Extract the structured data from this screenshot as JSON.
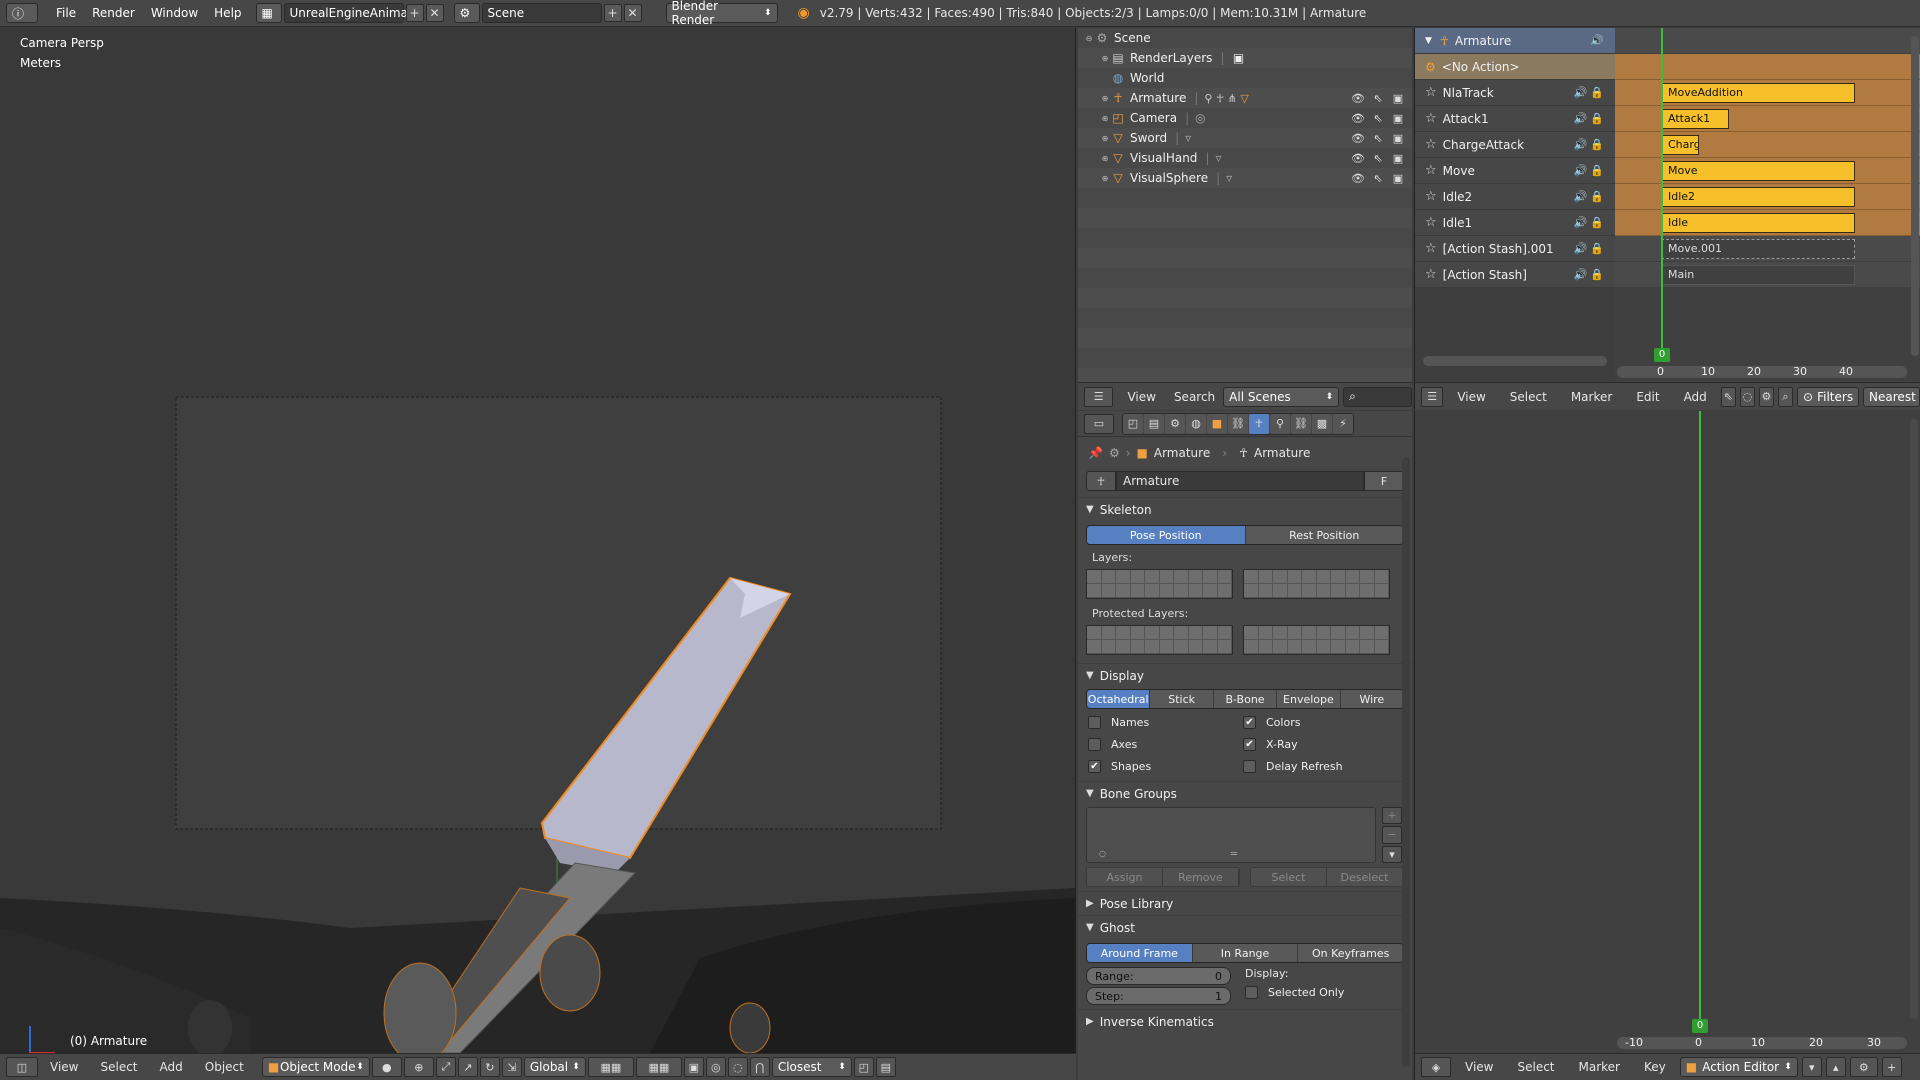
{
  "topbar": {
    "menus": [
      "File",
      "Render",
      "Window",
      "Help"
    ],
    "screen_layout": "UnrealEngineAnima...",
    "scene": "Scene",
    "engine": "Blender Render",
    "stats": "v2.79 | Verts:432 | Faces:490 | Tris:840 | Objects:2/3 | Lamps:0/0 | Mem:10.31M | Armature"
  },
  "viewport": {
    "view_name": "Camera Persp",
    "units": "Meters",
    "active_object": "(0) Armature",
    "footer": {
      "menus": [
        "View",
        "Select",
        "Add",
        "Object"
      ],
      "mode": "Object Mode",
      "orientation": "Global",
      "snap": "Closest"
    }
  },
  "outliner": {
    "rows": [
      {
        "label": "Scene",
        "icon": "scene-icon"
      },
      {
        "label": "RenderLayers",
        "icon": "render-layers-icon"
      },
      {
        "label": "World",
        "icon": "world-icon"
      },
      {
        "label": "Armature",
        "icon": "armature-icon"
      },
      {
        "label": "Camera",
        "icon": "camera-icon"
      },
      {
        "label": "Sword",
        "icon": "mesh-icon"
      },
      {
        "label": "VisualHand",
        "icon": "mesh-icon"
      },
      {
        "label": "VisualSphere",
        "icon": "mesh-icon"
      }
    ],
    "footer": {
      "menus": [
        "View",
        "Search"
      ],
      "filter": "All Scenes"
    }
  },
  "properties": {
    "breadcrumb": [
      "Armature",
      "Armature"
    ],
    "datablock": "Armature",
    "fake_user": "F",
    "skeleton": {
      "title": "Skeleton",
      "position_buttons": [
        "Pose Position",
        "Rest Position"
      ],
      "layers_label": "Layers:",
      "protected_label": "Protected Layers:"
    },
    "display": {
      "title": "Display",
      "types": [
        "Octahedral",
        "Stick",
        "B-Bone",
        "Envelope",
        "Wire"
      ],
      "options_left": [
        {
          "label": "Names",
          "checked": false
        },
        {
          "label": "Axes",
          "checked": false
        },
        {
          "label": "Shapes",
          "checked": true
        }
      ],
      "options_right": [
        {
          "label": "Colors",
          "checked": true
        },
        {
          "label": "X-Ray",
          "checked": true
        },
        {
          "label": "Delay Refresh",
          "checked": false
        }
      ]
    },
    "bone_groups": {
      "title": "Bone Groups",
      "buttons_left": [
        "Assign",
        "Remove"
      ],
      "buttons_right": [
        "Select",
        "Deselect"
      ]
    },
    "pose_library": {
      "title": "Pose Library"
    },
    "ghost": {
      "title": "Ghost",
      "modes": [
        "Around Frame",
        "In Range",
        "On Keyframes"
      ],
      "range_label": "Range:",
      "range_value": "0",
      "step_label": "Step:",
      "step_value": "1",
      "display_label": "Display:",
      "selected_only": "Selected Only"
    },
    "next_panel": "Inverse Kinematics"
  },
  "nla": {
    "object": "Armature",
    "no_action": "<No Action>",
    "tracks": [
      {
        "name": "NlaTrack",
        "strip": "MoveAddition"
      },
      {
        "name": "Attack1",
        "strip": "Attack1"
      },
      {
        "name": "ChargeAttack",
        "strip": "ChargeAttac"
      },
      {
        "name": "Move",
        "strip": "Move"
      },
      {
        "name": "Idle2",
        "strip": "Idle2"
      },
      {
        "name": "Idle1",
        "strip": "Idle"
      },
      {
        "name": "[Action Stash].001",
        "strip": "Move.001"
      },
      {
        "name": "[Action Stash]",
        "strip": "Main"
      }
    ],
    "current_frame": "0",
    "ruler": [
      "0",
      "10",
      "20",
      "30",
      "40"
    ],
    "footer": {
      "menus": [
        "View",
        "Select",
        "Marker",
        "Edit",
        "Add"
      ],
      "filters": "Filters",
      "snap": "Nearest Fra"
    }
  },
  "action_editor": {
    "current_frame": "0",
    "ruler": [
      "-10",
      "0",
      "10",
      "20",
      "30"
    ],
    "footer": {
      "menus": [
        "View",
        "Select",
        "Marker",
        "Key"
      ],
      "mode": "Action Editor"
    }
  }
}
